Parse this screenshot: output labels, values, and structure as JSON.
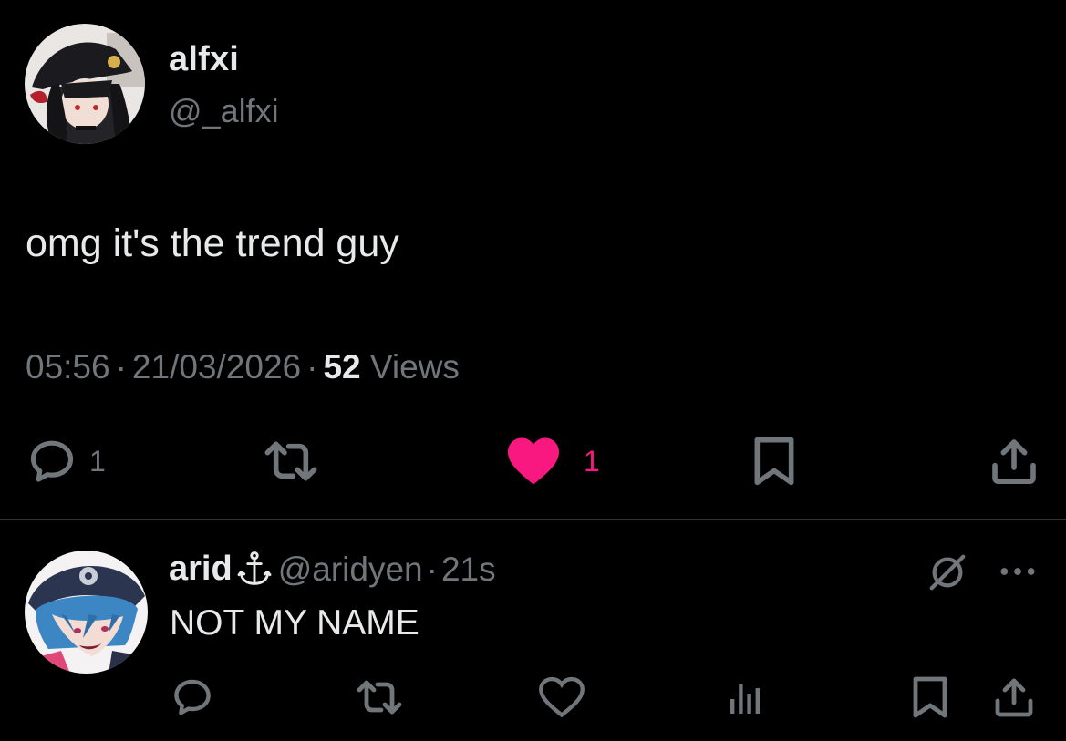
{
  "main_tweet": {
    "author_name": "alfxi",
    "author_handle": "@_alfxi",
    "text": "omg it's the trend guy",
    "time": "05:56",
    "separator": "·",
    "date": "21/03/2026",
    "views_count": "52",
    "views_label": "Views",
    "actions": {
      "reply_count": "1",
      "retweet_count": "",
      "like_count": "1",
      "reply_icon": "reply-bubble-icon",
      "retweet_icon": "retweet-icon",
      "like_icon": "heart-filled-icon",
      "bookmark_icon": "bookmark-icon",
      "share_icon": "share-icon"
    },
    "like_color": "#f91880"
  },
  "reply_tweet": {
    "author_name": "arid",
    "name_emoji_icon": "anchor-icon",
    "author_handle": "@aridyen",
    "separator": "·",
    "time": "21s",
    "text": "NOT MY NAME",
    "top_right_icons": [
      "grok-icon",
      "more-icon"
    ],
    "action_icons": [
      "reply-bubble-icon",
      "retweet-icon",
      "heart-icon",
      "views-icon",
      "bookmark-icon",
      "share-icon"
    ]
  },
  "colors": {
    "background": "#000000",
    "text_primary": "#e7e9ea",
    "text_secondary": "#71767b",
    "divider": "#2f3336"
  }
}
